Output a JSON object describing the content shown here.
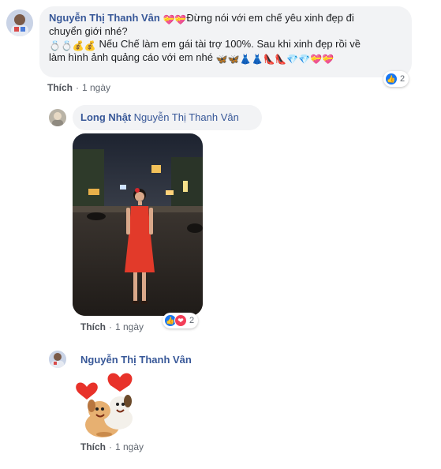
{
  "comments": [
    {
      "author": "Nguyễn Thị Thanh Vân",
      "line1_suffix": "Đừng nói với em chế yêu xinh đẹp đi",
      "line2": "chuyển giới nhé?",
      "line3_text": "Nếu Chế làm em gái tài trợ 100%. Sau khi xinh đẹp rồi về",
      "line4_text": "làm hình ảnh quảng cáo với em nhé",
      "like_label": "Thích",
      "time": "1 ngày",
      "reaction_count": "2"
    },
    {
      "author": "Long Nhật",
      "mention": "Nguyễn Thị Thanh Vân",
      "like_label": "Thích",
      "time": "1 ngày",
      "reaction_count": "2"
    },
    {
      "author": "Nguyễn Thị Thanh Vân",
      "like_label": "Thích",
      "time": "1 ngày"
    }
  ],
  "icons": {
    "heart_gift": "💝",
    "ring": "💍",
    "money_bag": "💰",
    "butterfly": "🦋",
    "dress": "👗",
    "heel": "👠",
    "gem": "💎"
  },
  "colors": {
    "name_blue": "#385898",
    "bubble_bg": "#f2f3f5",
    "meta_grey": "#606770",
    "like_blue": "#1877f2",
    "love_red": "#f33e58"
  }
}
